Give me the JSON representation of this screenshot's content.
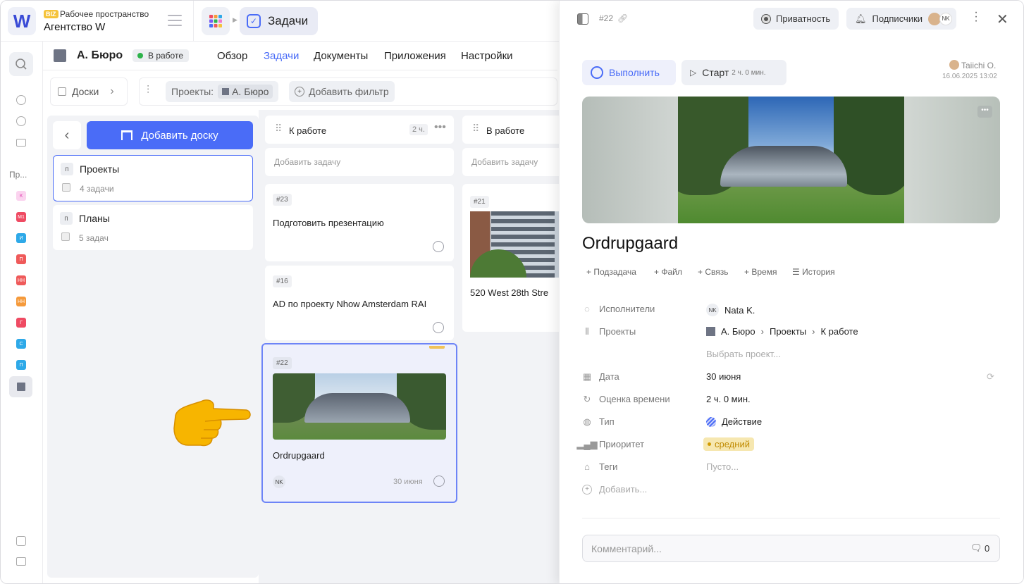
{
  "workspace": {
    "badge": "BIZ",
    "label": "Рабочее пространство",
    "name": "Агентство W",
    "logo_letter": "W"
  },
  "app": {
    "title": "Задачи"
  },
  "subnav": {
    "org": "А. Бюро",
    "status": "В работе",
    "tabs": [
      "Обзор",
      "Задачи",
      "Документы",
      "Приложения",
      "Настройки"
    ],
    "active_tab": "Задачи"
  },
  "filters": {
    "boards_label": "Доски",
    "projects_label": "Проекты:",
    "project_chip": "А. Бюро",
    "add_filter": "Добавить фильтр"
  },
  "rail": {
    "section_label": "Пр...",
    "projects": [
      {
        "letter": "К",
        "color": "#f07ad0"
      },
      {
        "letter": "М1",
        "color": "#ef4b63"
      },
      {
        "letter": "И",
        "color": "#2ea9e8"
      },
      {
        "letter": "П",
        "color": "#ef5a5a"
      },
      {
        "letter": "НН",
        "color": "#ef5a5a"
      },
      {
        "letter": "НН",
        "color": "#f59a3b"
      },
      {
        "letter": "Г",
        "color": "#ef4b63"
      },
      {
        "letter": "С",
        "color": "#2ea9e8"
      },
      {
        "letter": "П",
        "color": "#2ea9e8"
      }
    ]
  },
  "boards": {
    "add_label": "Добавить доску",
    "items": [
      {
        "letter": "п",
        "title": "Проекты",
        "count": "4 задачи"
      },
      {
        "letter": "п",
        "title": "Планы",
        "count": "5 задач"
      }
    ]
  },
  "columns": [
    {
      "title": "К работе",
      "badge": "2 ч.",
      "add_task": "Добавить задачу",
      "cards": [
        {
          "id": "#23",
          "title": "Подготовить презентацию"
        },
        {
          "id": "#16",
          "title": "AD по проекту Nhow Amsterdam RAI"
        },
        {
          "id": "#22",
          "title": "Ordrupgaard",
          "assignee": "NK",
          "date": "30 июня"
        }
      ]
    },
    {
      "title": "В работе",
      "add_task": "Добавить задачу",
      "cards": [
        {
          "id": "#21",
          "title": "520 West 28th Stre"
        }
      ]
    }
  ],
  "panel": {
    "task_id": "#22",
    "privacy": "Приватность",
    "subscribers": "Подписчики",
    "subscriber_initials": "NK",
    "complete": "Выполнить",
    "start": "Старт",
    "start_time": "2 ч. 0 мин.",
    "author": "Taiichi O.",
    "created": "16.06.2025 13:02",
    "title": "Ordrupgaard",
    "actions": [
      "Подзадача",
      "Файл",
      "Связь",
      "Время",
      "История"
    ],
    "props": {
      "assignees_label": "Исполнители",
      "assignee_initials": "NK",
      "assignee": "Nata K.",
      "projects_label": "Проекты",
      "path": [
        "А. Бюро",
        "Проекты",
        "К работе"
      ],
      "choose_project": "Выбрать проект...",
      "date_label": "Дата",
      "date": "30 июня",
      "estimate_label": "Оценка времени",
      "estimate": "2 ч. 0 мин.",
      "type_label": "Тип",
      "type": "Действие",
      "priority_label": "Приоритет",
      "priority": "средний",
      "tags_label": "Теги",
      "tags": "Пусто...",
      "add_label": "Добавить..."
    },
    "comment_placeholder": "Комментарий...",
    "comment_count": "0"
  },
  "colors": {
    "accent": "#4a6cf7",
    "priority": "#f6e7b0",
    "pointer": "#f7b500"
  }
}
